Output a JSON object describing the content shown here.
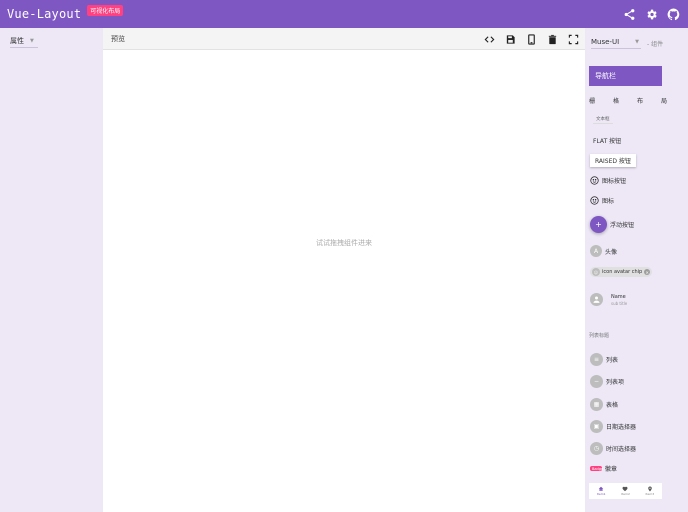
{
  "app": {
    "title": "Vue-Layout",
    "badge": "可视化布局",
    "colors": {
      "primary": "#7e57c2",
      "accent": "#ff4081",
      "panel_bg": "#ede7f6"
    },
    "actions": [
      "share-icon",
      "settings-icon",
      "github-icon"
    ]
  },
  "left_panel": {
    "property_select": "属性"
  },
  "preview": {
    "title": "预览",
    "tools": [
      "code-icon",
      "save-icon",
      "phone-icon",
      "delete-icon",
      "fullscreen-icon"
    ],
    "hint": "试试拖拽组件进来"
  },
  "right_panel": {
    "library_select": "Muse-UI",
    "library_suffix": "- 组件",
    "components": {
      "navbar": "导航栏",
      "grid": [
        "栅",
        "格",
        "布",
        "局"
      ],
      "small_button": "文本框",
      "flat_button": "FLAT 按钮",
      "raised_button": "RAISED 按钮",
      "icon_button": "图标按钮",
      "icon": "图标",
      "fab": "浮动按钮",
      "avatar": "头像",
      "avatar_letter": "A",
      "chip": "icon avatar chip",
      "list_item_name": "Name",
      "list_item_sub": "sub title",
      "list_header": "列表标题",
      "list": "列表",
      "list_item": "列表项",
      "table": "表格",
      "date_picker": "日期选择器",
      "time_picker": "时间选择器",
      "badge": "徽章",
      "badge_pill": "Badge",
      "bottom_nav": [
        "Item1",
        "Item2",
        "Item3"
      ]
    }
  }
}
